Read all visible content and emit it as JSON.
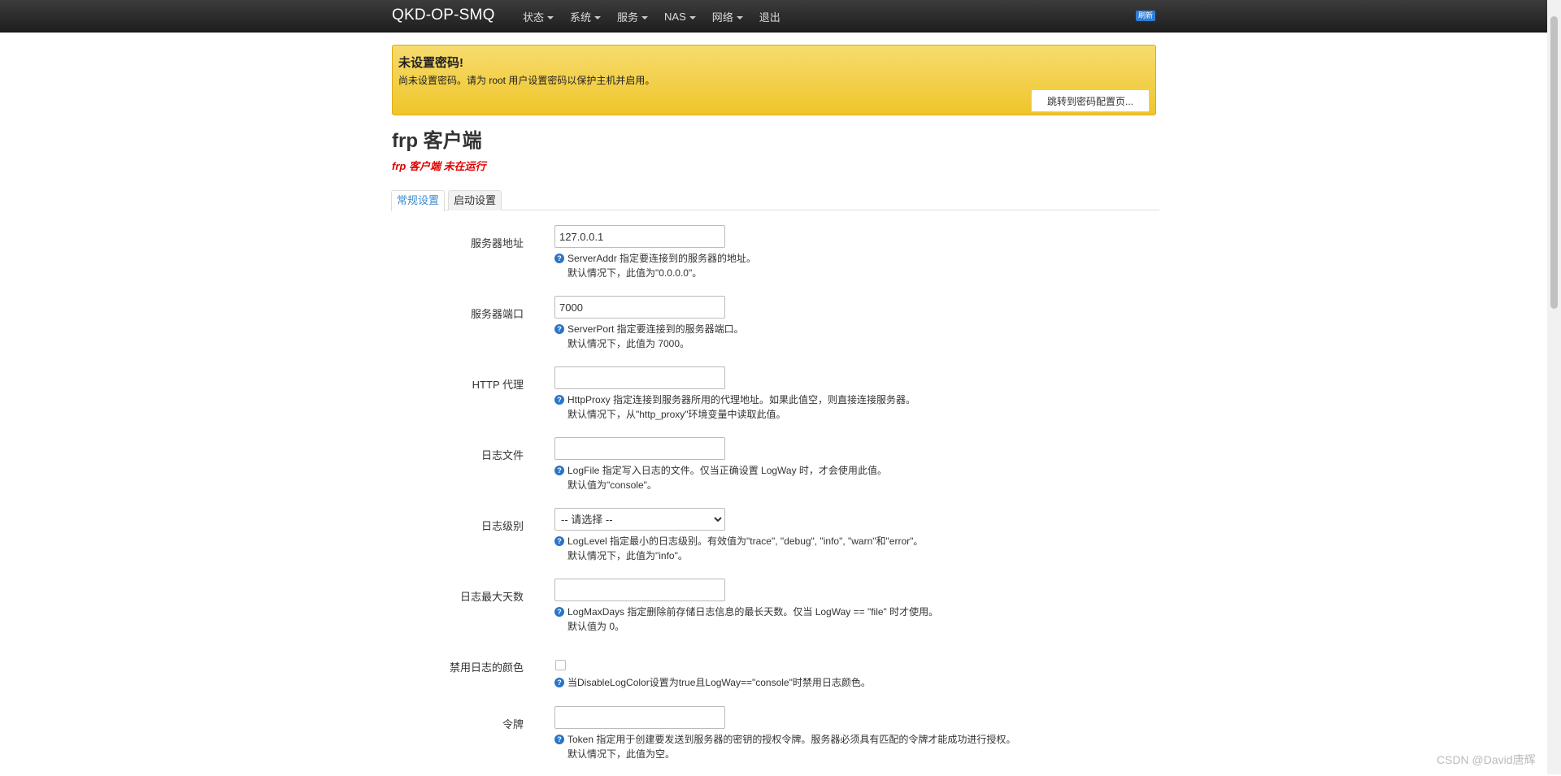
{
  "navbar": {
    "brand": "QKD-OP-SMQ",
    "items": [
      {
        "label": "状态",
        "dropdown": true
      },
      {
        "label": "系统",
        "dropdown": true
      },
      {
        "label": "服务",
        "dropdown": true
      },
      {
        "label": "NAS",
        "dropdown": true
      },
      {
        "label": "网络",
        "dropdown": true
      },
      {
        "label": "退出",
        "dropdown": false
      }
    ],
    "refresh_badge": "刷新"
  },
  "alert": {
    "title": "未设置密码!",
    "text": "尚未设置密码。请为 root 用户设置密码以保护主机并启用。",
    "button": "跳转到密码配置页..."
  },
  "page": {
    "title": "frp 客户端",
    "status": "frp 客户端 未在运行"
  },
  "tabs": [
    {
      "label": "常规设置",
      "active": true
    },
    {
      "label": "启动设置",
      "active": false
    }
  ],
  "form": {
    "server_addr": {
      "label": "服务器地址",
      "value": "127.0.0.1",
      "help1": "ServerAddr 指定要连接到的服务器的地址。",
      "help2": "默认情况下，此值为\"0.0.0.0\"。"
    },
    "server_port": {
      "label": "服务器端口",
      "value": "7000",
      "help1": "ServerPort 指定要连接到的服务器端口。",
      "help2": "默认情况下，此值为 7000。"
    },
    "http_proxy": {
      "label": "HTTP 代理",
      "value": "",
      "help1": "HttpProxy 指定连接到服务器所用的代理地址。如果此值空，则直接连接服务器。",
      "help2": "默认情况下，从\"http_proxy\"环境变量中读取此值。"
    },
    "log_file": {
      "label": "日志文件",
      "value": "",
      "help1": "LogFile 指定写入日志的文件。仅当正确设置 LogWay 时，才会使用此值。",
      "help2": "默认值为\"console\"。"
    },
    "log_level": {
      "label": "日志级别",
      "selected": "-- 请选择 --",
      "help1": "LogLevel 指定最小的日志级别。有效值为\"trace\", \"debug\", \"info\", \"warn\"和\"error\"。",
      "help2": "默认情况下，此值为\"info\"。"
    },
    "log_max_days": {
      "label": "日志最大天数",
      "value": "",
      "help1": "LogMaxDays 指定删除前存储日志信息的最长天数。仅当 LogWay == \"file\" 时才使用。",
      "help2": "默认值为 0。"
    },
    "disable_log_color": {
      "label": "禁用日志的颜色",
      "checked": false,
      "help1": "当DisableLogColor设置为true且LogWay==\"console\"时禁用日志颜色。"
    },
    "token": {
      "label": "令牌",
      "value": "",
      "help1": "Token 指定用于创建要发送到服务器的密钥的授权令牌。服务器必须具有匹配的令牌才能成功进行授权。",
      "help2": "默认情况下，此值为空。"
    }
  },
  "watermark": "CSDN @David唐辉",
  "colors": {
    "navbar_bg": "#2b2b2b",
    "alert_bg": "#f0c832",
    "status_text": "#e00000",
    "tab_active_text": "#3c8ad1",
    "help_icon": "#2a74c8"
  }
}
